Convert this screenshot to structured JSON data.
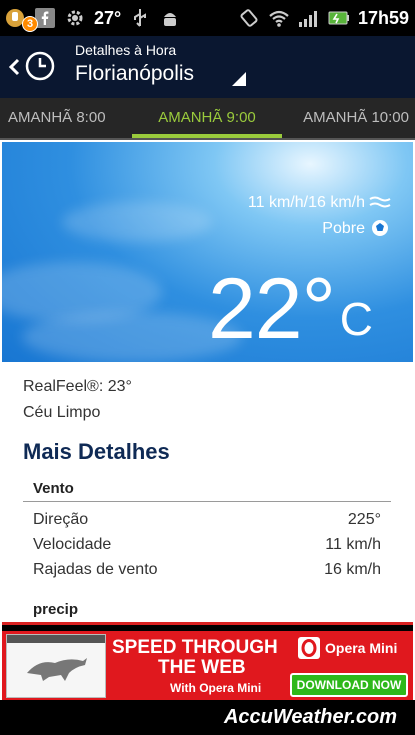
{
  "status_bar": {
    "notification_badge": "3",
    "temperature": "27°",
    "time": "17h59",
    "icons": [
      "notification-icon",
      "facebook-icon",
      "settings-cog-icon",
      "usb-icon",
      "android-debug-icon",
      "rotate-icon",
      "wifi-icon",
      "signal-icon",
      "battery-icon"
    ]
  },
  "header": {
    "subtitle": "Detalhes à Hora",
    "city": "Florianópolis"
  },
  "tabs": [
    {
      "label": "AMANHÃ 8:00"
    },
    {
      "label": "AMANHÃ 9:00",
      "selected": true
    },
    {
      "label": "AMANHÃ 10:00"
    }
  ],
  "hero": {
    "wind": "11 km/h/16 km/h",
    "air_quality": "Pobre",
    "temperature": "22°",
    "unit": "C"
  },
  "details": {
    "realfeel": "RealFeel®: 23°",
    "condition": "Céu Limpo",
    "more_title": "Mais Detalhes",
    "wind_section": {
      "title": "Vento",
      "rows": [
        {
          "label": "Direção",
          "value": "225°"
        },
        {
          "label": "Velocidade",
          "value": "11 km/h"
        },
        {
          "label": "Rajadas de vento",
          "value": "16 km/h"
        }
      ]
    },
    "precip_title": "precip"
  },
  "ad": {
    "headline1": "SPEED THROUGH",
    "headline2": "THE WEB",
    "sub": "With Opera Mini",
    "brand": "Opera Mini",
    "cta": "DOWNLOAD NOW",
    "colors": {
      "background": "#e0181e",
      "cta": "#2eb81a"
    }
  },
  "footer": {
    "brand": "AccuWeather.com"
  },
  "colors": {
    "header_bg": "#0a1730",
    "tab_active": "#9acb3c",
    "title_color": "#0f2a55"
  }
}
